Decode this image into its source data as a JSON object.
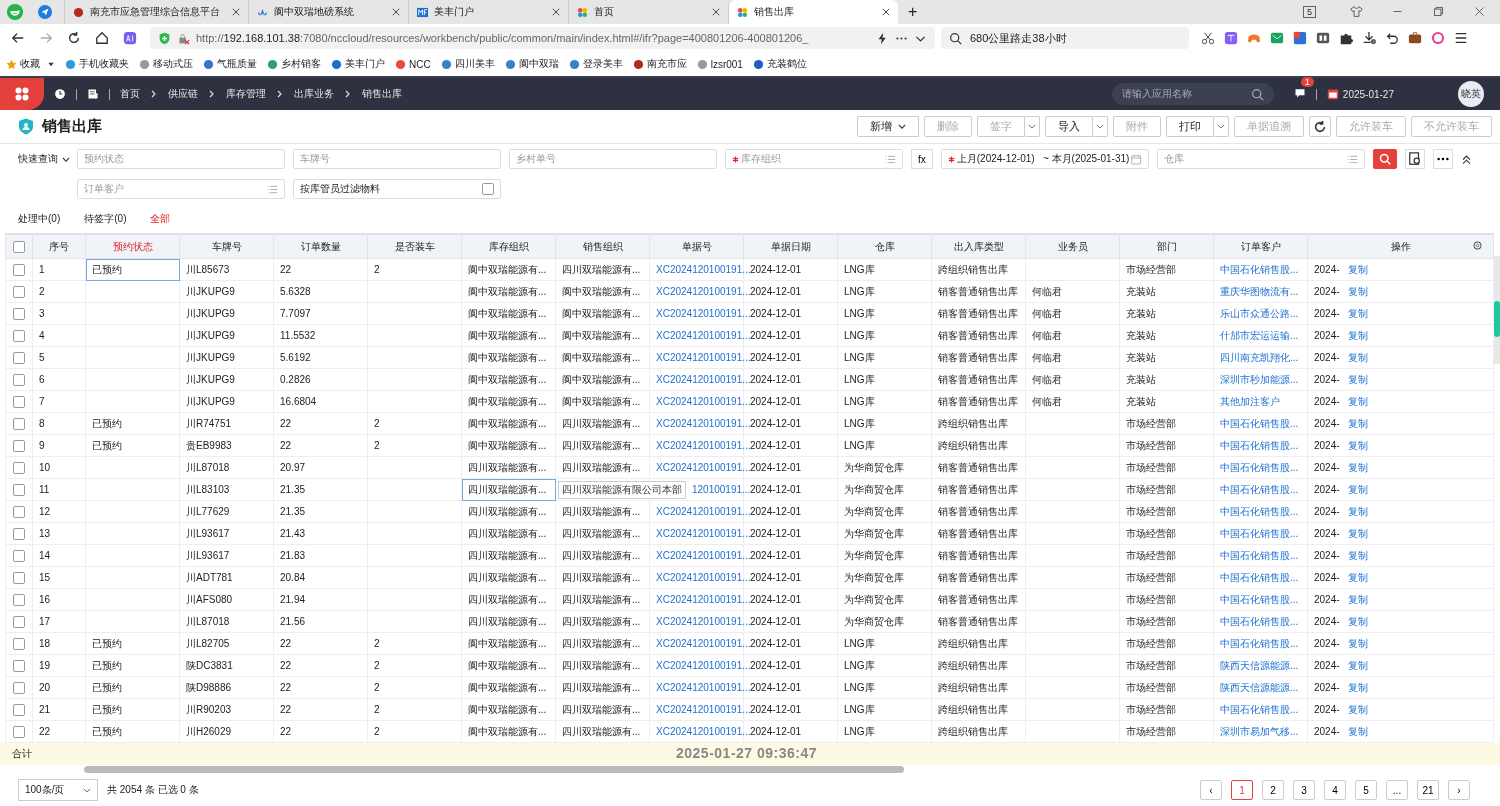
{
  "browser": {
    "tabs": [
      {
        "title": "南充市应急管理综合信息平台",
        "selected": false
      },
      {
        "title": "阆中双瑞地磅系统",
        "selected": false
      },
      {
        "title": "美丰门户",
        "selected": false
      },
      {
        "title": "首页",
        "selected": false
      },
      {
        "title": "销售出库",
        "selected": true
      }
    ],
    "tab_count": "5",
    "new_tab": "+",
    "address": {
      "scheme": "http://",
      "host": "192.168.101.38",
      "rest": ":7080/nccloud/resources/workbench/public/common/main/index.html#/ifr?page=400801206-400801206_"
    },
    "search": "680公里路走38小时",
    "bookmarks": [
      "收藏",
      "手机收藏夹",
      "移动式压",
      "气瓶质量",
      "乡村销客",
      "美丰门户",
      "NCC",
      "四川美丰",
      "阆中双瑞",
      "登录美丰",
      "南充市应",
      "lzsr001",
      "充装鹤位"
    ]
  },
  "app_header": {
    "breadcrumb": [
      "首页",
      "供应链",
      "库存管理",
      "出库业务",
      "销售出库"
    ],
    "search_placeholder": "请输入应用名称",
    "message_count": "1",
    "date": "2025-01-27",
    "avatar": "晓英"
  },
  "page": {
    "title": "销售出库",
    "toolbar": [
      {
        "label": "新增",
        "disabled": false,
        "dropdown": true
      },
      {
        "label": "删除",
        "disabled": true,
        "dropdown": false
      },
      {
        "label": "签字",
        "disabled": true,
        "dropdown": true
      },
      {
        "label": "导入",
        "disabled": false,
        "dropdown": true
      },
      {
        "label": "附件",
        "disabled": true,
        "dropdown": false
      },
      {
        "label": "打印",
        "disabled": false,
        "dropdown": true
      },
      {
        "label": "单据追溯",
        "disabled": true,
        "dropdown": false
      },
      {
        "label": "允许装车",
        "disabled": true,
        "dropdown": false
      },
      {
        "label": "不允许装车",
        "disabled": true,
        "dropdown": false
      }
    ]
  },
  "filters": {
    "quick_query": "快速查询",
    "row1": [
      {
        "placeholder": "预约状态",
        "required": false,
        "list": false
      },
      {
        "placeholder": "车牌号",
        "required": false,
        "list": false
      },
      {
        "placeholder": "乡村单号",
        "required": false,
        "list": false
      },
      {
        "placeholder": "库存组织",
        "required": true,
        "list": true
      }
    ],
    "fx": "fx",
    "date_range": {
      "value": "上月(2024-12-01)   ~ 本月(2025-01-31)",
      "required": true
    },
    "warehouse": {
      "placeholder": "仓库",
      "required": false,
      "list": true
    },
    "row2": [
      {
        "placeholder": "订单客户",
        "required": false,
        "list": true
      }
    ],
    "filter_by_keeper": {
      "label": "按库管员过滤物料",
      "checked": false
    }
  },
  "status_tabs": [
    {
      "label": "处理中(0)",
      "selected": false
    },
    {
      "label": "待签字(0)",
      "selected": false
    },
    {
      "label": "全部",
      "selected": true
    }
  ],
  "table": {
    "select_all": {
      "checked": false
    },
    "columns": [
      {
        "label": "序号",
        "kind": "text",
        "active": false
      },
      {
        "label": "预约状态",
        "kind": "text",
        "active": true
      },
      {
        "label": "车牌号",
        "kind": "text",
        "active": false
      },
      {
        "label": "订单数量",
        "kind": "text",
        "active": false
      },
      {
        "label": "是否装车",
        "kind": "text",
        "active": false
      },
      {
        "label": "库存组织",
        "kind": "text",
        "active": false
      },
      {
        "label": "销售组织",
        "kind": "text",
        "active": false
      },
      {
        "label": "单据号",
        "kind": "link",
        "active": false
      },
      {
        "label": "单据日期",
        "kind": "text",
        "active": false
      },
      {
        "label": "仓库",
        "kind": "text",
        "active": false
      },
      {
        "label": "出入库类型",
        "kind": "text",
        "active": false
      },
      {
        "label": "业务员",
        "kind": "text",
        "active": false
      },
      {
        "label": "部门",
        "kind": "text",
        "active": false
      },
      {
        "label": "订单客户",
        "kind": "link",
        "active": false
      },
      {
        "label": "操作",
        "kind": "action",
        "active": false
      }
    ],
    "rows": [
      {
        "checked": false,
        "cells": [
          "1",
          {
            "text": "已预约",
            "focused": true
          },
          "川L85673",
          "22",
          "2",
          "阆中双瑞能源有...",
          "四川双瑞能源有...",
          "XC2024120100191...",
          "2024-12-01",
          "LNG库",
          "跨组织销售出库",
          "",
          "市场经营部",
          "中国石化销售股...",
          "2024-"
        ],
        "action": "复制"
      },
      {
        "checked": false,
        "cells": [
          "2",
          "",
          "川JKUPG9",
          "5.6328",
          "",
          "阆中双瑞能源有...",
          "阆中双瑞能源有...",
          "XC2024120100191...",
          "2024-12-01",
          "LNG库",
          "销客普通销售出库",
          "何临君",
          "充装站",
          "重庆华图物流有...",
          "2024-"
        ],
        "action": "复制"
      },
      {
        "checked": false,
        "cells": [
          "3",
          "",
          "川JKUPG9",
          "7.7097",
          "",
          "阆中双瑞能源有...",
          "阆中双瑞能源有...",
          "XC2024120100191...",
          "2024-12-01",
          "LNG库",
          "销客普通销售出库",
          "何临君",
          "充装站",
          "乐山市众通公路...",
          "2024-"
        ],
        "action": "复制"
      },
      {
        "checked": false,
        "cells": [
          "4",
          "",
          "川JKUPG9",
          "11.5532",
          "",
          "阆中双瑞能源有...",
          "阆中双瑞能源有...",
          "XC2024120100191...",
          "2024-12-01",
          "LNG库",
          "销客普通销售出库",
          "何临君",
          "充装站",
          "什邡市宏运运输...",
          "2024-"
        ],
        "action": "复制"
      },
      {
        "checked": false,
        "cells": [
          "5",
          "",
          "川JKUPG9",
          "5.6192",
          "",
          "阆中双瑞能源有...",
          "阆中双瑞能源有...",
          "XC2024120100191...",
          "2024-12-01",
          "LNG库",
          "销客普通销售出库",
          "何临君",
          "充装站",
          "四川南充凯翔化...",
          "2024-"
        ],
        "action": "复制"
      },
      {
        "checked": false,
        "cells": [
          "6",
          "",
          "川JKUPG9",
          "0.2826",
          "",
          "阆中双瑞能源有...",
          "阆中双瑞能源有...",
          "XC2024120100191...",
          "2024-12-01",
          "LNG库",
          "销客普通销售出库",
          "何临君",
          "充装站",
          "深圳市秒加能源...",
          "2024-"
        ],
        "action": "复制"
      },
      {
        "checked": false,
        "cells": [
          "7",
          "",
          "川JKUPG9",
          "16.6804",
          "",
          "阆中双瑞能源有...",
          "阆中双瑞能源有...",
          "XC2024120100191...",
          "2024-12-01",
          "LNG库",
          "销客普通销售出库",
          "何临君",
          "充装站",
          "其他加注客户",
          "2024-"
        ],
        "action": "复制"
      },
      {
        "checked": false,
        "cells": [
          "8",
          "已预约",
          "川R74751",
          "22",
          "2",
          "阆中双瑞能源有...",
          "四川双瑞能源有...",
          "XC2024120100191...",
          "2024-12-01",
          "LNG库",
          "跨组织销售出库",
          "",
          "市场经营部",
          "中国石化销售股...",
          "2024-"
        ],
        "action": "复制"
      },
      {
        "checked": false,
        "cells": [
          "9",
          "已预约",
          "贵EB9983",
          "22",
          "2",
          "阆中双瑞能源有...",
          "四川双瑞能源有...",
          "XC2024120100191...",
          "2024-12-01",
          "LNG库",
          "跨组织销售出库",
          "",
          "市场经营部",
          "中国石化销售股...",
          "2024-"
        ],
        "action": "复制"
      },
      {
        "checked": false,
        "cells": [
          "10",
          "",
          "川L87018",
          "20.97",
          "",
          "四川双瑞能源有...",
          "四川双瑞能源有...",
          "XC2024120100191...",
          "2024-12-01",
          "为华商贸仓库",
          "销客普通销售出库",
          "",
          "市场经营部",
          "中国石化销售股...",
          "2024-"
        ],
        "action": "复制"
      },
      {
        "checked": false,
        "cells": [
          "11",
          "",
          "川L83103",
          "21.35",
          "",
          {
            "text": "四川双瑞能源有...",
            "focused": true,
            "tooltip": "四川双瑞能源有限公司本部"
          },
          "",
          "120100191...",
          "2024-12-01",
          "为华商贸仓库",
          "销客普通销售出库",
          "",
          "市场经营部",
          "中国石化销售股...",
          "2024-"
        ],
        "action": "复制"
      },
      {
        "checked": false,
        "cells": [
          "12",
          "",
          "川L77629",
          "21.35",
          "",
          "四川双瑞能源有...",
          "四川双瑞能源有...",
          "XC2024120100191...",
          "2024-12-01",
          "为华商贸仓库",
          "销客普通销售出库",
          "",
          "市场经营部",
          "中国石化销售股...",
          "2024-"
        ],
        "action": "复制"
      },
      {
        "checked": false,
        "cells": [
          "13",
          "",
          "川L93617",
          "21.43",
          "",
          "四川双瑞能源有...",
          "四川双瑞能源有...",
          "XC2024120100191...",
          "2024-12-01",
          "为华商贸仓库",
          "销客普通销售出库",
          "",
          "市场经营部",
          "中国石化销售股...",
          "2024-"
        ],
        "action": "复制"
      },
      {
        "checked": false,
        "cells": [
          "14",
          "",
          "川L93617",
          "21.83",
          "",
          "四川双瑞能源有...",
          "四川双瑞能源有...",
          "XC2024120100191...",
          "2024-12-01",
          "为华商贸仓库",
          "销客普通销售出库",
          "",
          "市场经营部",
          "中国石化销售股...",
          "2024-"
        ],
        "action": "复制"
      },
      {
        "checked": false,
        "cells": [
          "15",
          "",
          "川ADT781",
          "20.84",
          "",
          "四川双瑞能源有...",
          "四川双瑞能源有...",
          "XC2024120100191...",
          "2024-12-01",
          "为华商贸仓库",
          "销客普通销售出库",
          "",
          "市场经营部",
          "中国石化销售股...",
          "2024-"
        ],
        "action": "复制"
      },
      {
        "checked": false,
        "cells": [
          "16",
          "",
          "川AFS080",
          "21.94",
          "",
          "四川双瑞能源有...",
          "四川双瑞能源有...",
          "XC2024120100191...",
          "2024-12-01",
          "为华商贸仓库",
          "销客普通销售出库",
          "",
          "市场经营部",
          "中国石化销售股...",
          "2024-"
        ],
        "action": "复制"
      },
      {
        "checked": false,
        "cells": [
          "17",
          "",
          "川L87018",
          "21.56",
          "",
          "四川双瑞能源有...",
          "四川双瑞能源有...",
          "XC2024120100191...",
          "2024-12-01",
          "为华商贸仓库",
          "销客普通销售出库",
          "",
          "市场经营部",
          "中国石化销售股...",
          "2024-"
        ],
        "action": "复制"
      },
      {
        "checked": false,
        "cells": [
          "18",
          "已预约",
          "川L82705",
          "22",
          "2",
          "阆中双瑞能源有...",
          "四川双瑞能源有...",
          "XC2024120100191...",
          "2024-12-01",
          "LNG库",
          "跨组织销售出库",
          "",
          "市场经营部",
          "中国石化销售股...",
          "2024-"
        ],
        "action": "复制"
      },
      {
        "checked": false,
        "cells": [
          "19",
          "已预约",
          "陕DC3831",
          "22",
          "2",
          "阆中双瑞能源有...",
          "四川双瑞能源有...",
          "XC2024120100191...",
          "2024-12-01",
          "LNG库",
          "跨组织销售出库",
          "",
          "市场经营部",
          "陕西天信源能源...",
          "2024-"
        ],
        "action": "复制"
      },
      {
        "checked": false,
        "cells": [
          "20",
          "已预约",
          "陕D98886",
          "22",
          "2",
          "阆中双瑞能源有...",
          "四川双瑞能源有...",
          "XC2024120100191...",
          "2024-12-01",
          "LNG库",
          "跨组织销售出库",
          "",
          "市场经营部",
          "陕西天信源能源...",
          "2024-"
        ],
        "action": "复制"
      },
      {
        "checked": false,
        "cells": [
          "21",
          "已预约",
          "川R90203",
          "22",
          "2",
          "阆中双瑞能源有...",
          "四川双瑞能源有...",
          "XC2024120100191...",
          "2024-12-01",
          "LNG库",
          "跨组织销售出库",
          "",
          "市场经营部",
          "中国石化销售股...",
          "2024-"
        ],
        "action": "复制"
      },
      {
        "checked": false,
        "cells": [
          "22",
          "已预约",
          "川H26029",
          "22",
          "2",
          "阆中双瑞能源有...",
          "四川双瑞能源有...",
          "XC2024120100191...",
          "2024-12-01",
          "LNG库",
          "跨组织销售出库",
          "",
          "市场经营部",
          "深圳市易加气移...",
          "2024-"
        ],
        "action": "复制"
      }
    ],
    "summary_label": "合计"
  },
  "overlay_timestamp": "2025-01-27 09:36:47",
  "footer": {
    "page_size": "100条/页",
    "total": "共 2054 条 已选 0 条",
    "prev": "‹",
    "next": "›",
    "pages": [
      {
        "label": "1",
        "selected": true
      },
      {
        "label": "2",
        "selected": false
      },
      {
        "label": "3",
        "selected": false
      },
      {
        "label": "4",
        "selected": false
      },
      {
        "label": "5",
        "selected": false
      },
      {
        "label": "...",
        "selected": false
      },
      {
        "label": "21",
        "selected": false
      }
    ]
  }
}
